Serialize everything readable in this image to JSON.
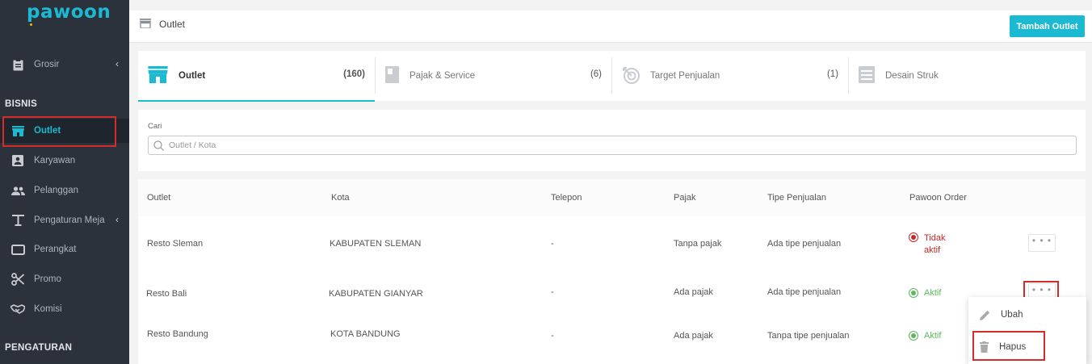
{
  "app": {
    "logo": "pawoon"
  },
  "sidebar": {
    "items_top": [
      {
        "label": "Grosir",
        "icon": "document-icon"
      }
    ],
    "section_bisnis": "BISNIS",
    "items": [
      {
        "label": "Outlet",
        "icon": "store-icon"
      },
      {
        "label": "Karyawan",
        "icon": "person-card-icon"
      },
      {
        "label": "Pelanggan",
        "icon": "people-icon"
      },
      {
        "label": "Pengaturan Meja",
        "icon": "table-icon"
      },
      {
        "label": "Perangkat",
        "icon": "device-icon"
      },
      {
        "label": "Promo",
        "icon": "scissors-icon"
      },
      {
        "label": "Komisi",
        "icon": "handshake-icon"
      }
    ],
    "section_pengaturan": "PENGATURAN"
  },
  "header": {
    "title": "Outlet",
    "add_button": "Tambah Outlet"
  },
  "tabs": [
    {
      "label": "Outlet",
      "count": "(160)"
    },
    {
      "label": "Pajak & Service",
      "count": "(6)"
    },
    {
      "label": "Target Penjualan",
      "count": "(1)"
    },
    {
      "label": "Desain Struk",
      "count": ""
    }
  ],
  "search": {
    "label": "Cari",
    "placeholder": "Outlet / Kota",
    "value": ""
  },
  "table": {
    "columns": [
      "Outlet",
      "Kota",
      "Telepon",
      "Pajak",
      "Tipe Penjualan",
      "Pawoon Order"
    ],
    "rows": [
      {
        "outlet": "Resto Sleman",
        "kota": "KABUPATEN SLEMAN",
        "telepon": "-",
        "pajak": "Tanpa pajak",
        "tipe": "Ada tipe penjualan",
        "order_line1": "Tidak",
        "order_line2": "aktif",
        "order_state": "off"
      },
      {
        "outlet": "Resto Bali",
        "kota": "KABUPATEN GIANYAR",
        "telepon": "-",
        "pajak": "Ada pajak",
        "tipe": "Ada tipe penjualan",
        "order_line1": "Aktif",
        "order_line2": "",
        "order_state": "on"
      },
      {
        "outlet": "Resto Bandung",
        "kota": "KOTA BANDUNG",
        "telepon": "-",
        "pajak": "Ada pajak",
        "tipe": "Tanpa tipe penjualan",
        "order_line1": "Aktif",
        "order_line2": "",
        "order_state": "on"
      }
    ],
    "more_label": "• • •"
  },
  "menu": {
    "edit": "Ubah",
    "delete": "Hapus"
  },
  "colors": {
    "accent": "#1cb9d2",
    "sidebar": "#2b323b",
    "highlight": "#d62b2b",
    "inactive": "#c62828",
    "active": "#5cb85c"
  }
}
